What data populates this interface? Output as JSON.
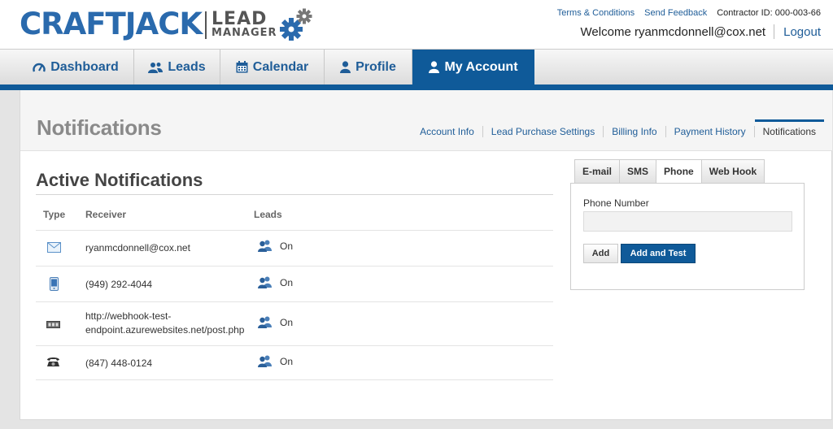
{
  "header": {
    "logo_text": "CRAFTJACK",
    "logo_lead": "LEAD",
    "logo_manager": "MANAGER",
    "links": {
      "terms": "Terms & Conditions",
      "feedback": "Send Feedback"
    },
    "contractor_id": "Contractor ID: 000-003-66",
    "welcome": "Welcome ryanmcdonnell@cox.net",
    "logout": "Logout"
  },
  "nav": {
    "dashboard": "Dashboard",
    "leads": "Leads",
    "calendar": "Calendar",
    "profile": "Profile",
    "my_account": "My Account",
    "active": "My Account"
  },
  "page": {
    "title": "Notifications",
    "subnav": {
      "account_info": "Account Info",
      "lead_purchase": "Lead Purchase Settings",
      "billing": "Billing Info",
      "payment": "Payment History",
      "notifications": "Notifications"
    }
  },
  "active_notifications": {
    "heading": "Active Notifications",
    "columns": {
      "type": "Type",
      "receiver": "Receiver",
      "leads": "Leads"
    },
    "rows": [
      {
        "icon": "email-icon",
        "receiver": "ryanmcdonnell@cox.net",
        "leads": "On"
      },
      {
        "icon": "mobile-phone-icon",
        "receiver": "(949) 292-4044",
        "leads": "On"
      },
      {
        "icon": "webhook-icon",
        "receiver": "http://webhook-test-endpoint.azurewebsites.net/post.php",
        "leads": "On"
      },
      {
        "icon": "telephone-icon",
        "receiver": "(847) 448-0124",
        "leads": "On"
      }
    ]
  },
  "add_panel": {
    "tabs": {
      "email": "E-mail",
      "sms": "SMS",
      "phone": "Phone",
      "webhook": "Web Hook"
    },
    "active_tab": "Phone",
    "phone_label": "Phone Number",
    "phone_value": "",
    "add": "Add",
    "add_test": "Add and Test"
  },
  "colors": {
    "brand_blue": "#0f5a99",
    "link_blue": "#1f5d98",
    "logo_blue": "#2a6aad"
  }
}
